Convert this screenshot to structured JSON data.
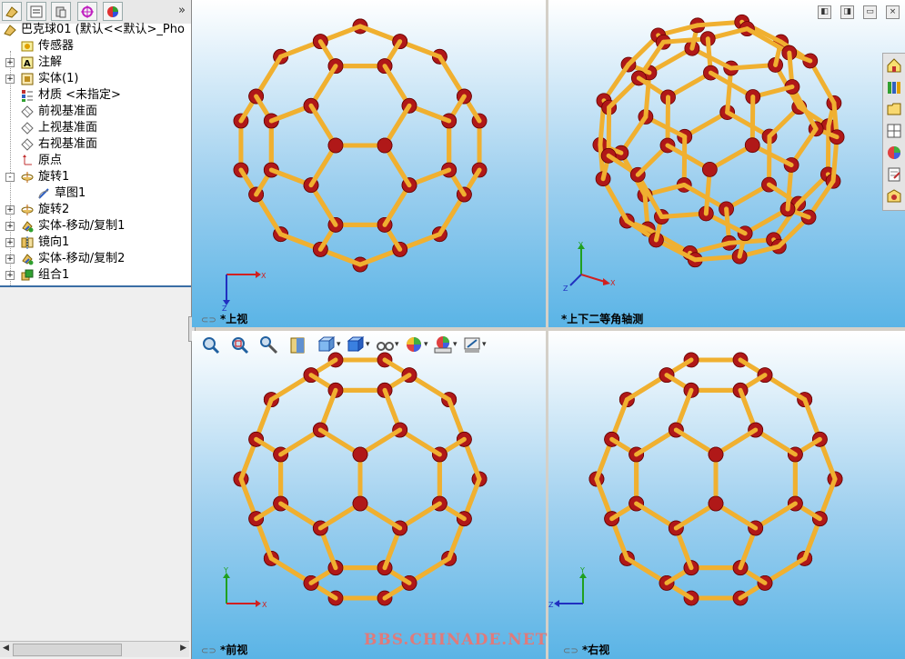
{
  "feature_manager": {
    "tabs": [
      "feature-manager-tab",
      "property-manager-tab",
      "configuration-manager-tab",
      "dimxpert-tab",
      "display-manager-tab"
    ],
    "expand_glyph": "»",
    "tree": [
      {
        "label": "巴克球01 (默认<<默认>_Pho",
        "icon": "part-icon",
        "expand": "",
        "indent": 0
      },
      {
        "label": "传感器",
        "icon": "sensor-icon",
        "expand": "",
        "indent": 1
      },
      {
        "label": "注解",
        "icon": "annotation-icon",
        "expand": "+",
        "indent": 1
      },
      {
        "label": "实体(1)",
        "icon": "solid-bodies-icon",
        "expand": "+",
        "indent": 1
      },
      {
        "label": "材质 <未指定>",
        "icon": "material-icon",
        "expand": "",
        "indent": 1
      },
      {
        "label": "前视基准面",
        "icon": "plane-icon",
        "expand": "",
        "indent": 1
      },
      {
        "label": "上视基准面",
        "icon": "plane-icon",
        "expand": "",
        "indent": 1
      },
      {
        "label": "右视基准面",
        "icon": "plane-icon",
        "expand": "",
        "indent": 1
      },
      {
        "label": "原点",
        "icon": "origin-icon",
        "expand": "",
        "indent": 1
      },
      {
        "label": "旋转1",
        "icon": "revolve-icon",
        "expand": "-",
        "indent": 1
      },
      {
        "label": "草图1",
        "icon": "sketch-icon",
        "expand": "",
        "indent": 2
      },
      {
        "label": "旋转2",
        "icon": "revolve-icon",
        "expand": "+",
        "indent": 1
      },
      {
        "label": "实体-移动/复制1",
        "icon": "move-copy-icon",
        "expand": "+",
        "indent": 1
      },
      {
        "label": "镜向1",
        "icon": "mirror-icon",
        "expand": "+",
        "indent": 1
      },
      {
        "label": "实体-移动/复制2",
        "icon": "move-copy-icon",
        "expand": "+",
        "indent": 1
      },
      {
        "label": "组合1",
        "icon": "combine-icon",
        "expand": "+",
        "indent": 1
      }
    ]
  },
  "viewports": [
    {
      "id": "top",
      "label": "*上视",
      "triad": [
        "X",
        "Z"
      ]
    },
    {
      "id": "iso",
      "label": "*上下二等角轴测",
      "triad": [
        "Y",
        "X",
        "Z"
      ]
    },
    {
      "id": "front",
      "label": "*前视",
      "triad": [
        "Y",
        "X"
      ]
    },
    {
      "id": "right",
      "label": "*右视",
      "triad": [
        "Y",
        "Z"
      ]
    }
  ],
  "view_toolbar": [
    "zoom-to-fit-icon",
    "zoom-to-area-icon",
    "previous-view-icon",
    "section-view-icon",
    "view-orientation-icon",
    "display-style-icon",
    "hide-show-items-icon",
    "edit-appearance-icon",
    "apply-scene-icon",
    "view-settings-icon"
  ],
  "task_pane": [
    "solidworks-resources-icon",
    "design-library-icon",
    "file-explorer-icon",
    "view-palette-icon",
    "appearances-icon",
    "custom-properties-icon",
    "toolbox-icon"
  ],
  "window_controls": [
    "prev-icon",
    "next-icon",
    "restore-icon",
    "close-icon"
  ],
  "watermark": "BBS.CHINADE.NET",
  "colors": {
    "bond": "#f0b030",
    "atom": "#b01818",
    "viewport_top": "#ffffff",
    "viewport_bottom": "#5ab4e6"
  }
}
